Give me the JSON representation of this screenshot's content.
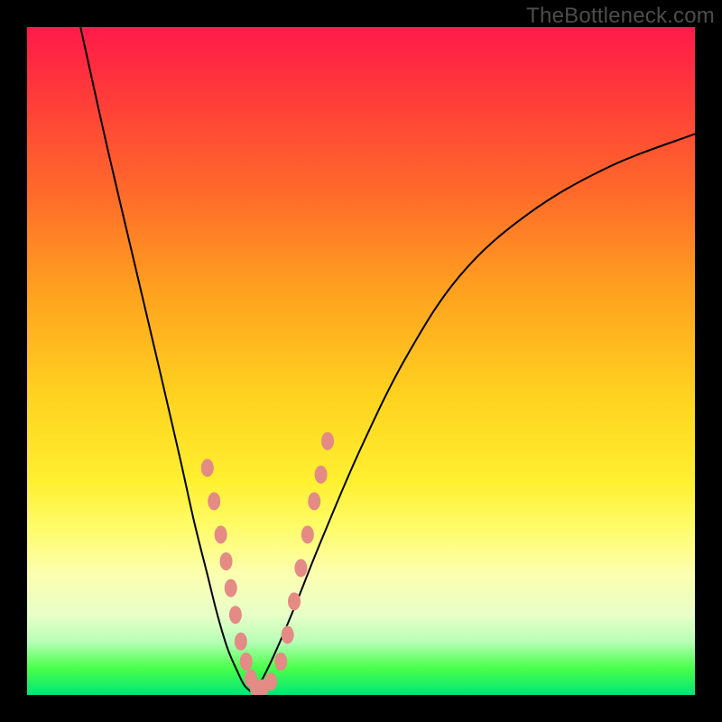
{
  "watermark": "TheBottleneck.com",
  "chart_data": {
    "type": "line",
    "title": "",
    "xlabel": "",
    "ylabel": "",
    "xlim": [
      0,
      100
    ],
    "ylim": [
      0,
      100
    ],
    "grid": false,
    "legend": false,
    "series": [
      {
        "name": "left-curve",
        "x": [
          8,
          12,
          16,
          20,
          23,
          25,
          27,
          28.5,
          30,
          31.5,
          32.5,
          33.5
        ],
        "values": [
          100,
          82,
          65,
          48,
          35,
          26,
          18,
          12,
          7,
          3.5,
          1.5,
          0.5
        ],
        "stroke": "#000000"
      },
      {
        "name": "right-curve",
        "x": [
          33.5,
          35,
          37,
          40,
          44,
          50,
          57,
          65,
          75,
          87,
          100
        ],
        "values": [
          0.5,
          2,
          6,
          13,
          23,
          37,
          51,
          63,
          72,
          79,
          84
        ],
        "stroke": "#000000"
      },
      {
        "name": "markers",
        "type": "scatter",
        "x": [
          27,
          28,
          29,
          29.8,
          30.5,
          31.2,
          32,
          32.8,
          33.5,
          34.3,
          35.2,
          36.5,
          38,
          39,
          40,
          41,
          42,
          43,
          44,
          45
        ],
        "values": [
          34,
          29,
          24,
          20,
          16,
          12,
          8,
          5,
          2.5,
          1,
          1,
          2,
          5,
          9,
          14,
          19,
          24,
          29,
          33,
          38
        ],
        "marker_color": "#e38b84",
        "marker_rx": 7,
        "marker_ry": 10
      }
    ],
    "background_gradient": {
      "type": "vertical",
      "stops": [
        {
          "pos": 0.0,
          "color": "#ff1a4a"
        },
        {
          "pos": 0.25,
          "color": "#ff6b2a"
        },
        {
          "pos": 0.55,
          "color": "#ffd21f"
        },
        {
          "pos": 0.82,
          "color": "#fbffb0"
        },
        {
          "pos": 1.0,
          "color": "#00e676"
        }
      ]
    }
  }
}
